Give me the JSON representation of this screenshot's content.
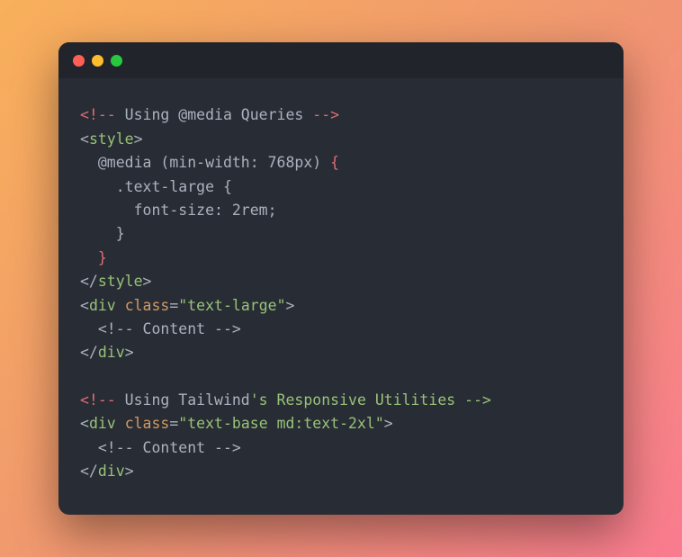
{
  "code": {
    "l1": {
      "a": "<!-- ",
      "b": "Using @media Queries ",
      "c": "-->"
    },
    "l2": {
      "a": "<",
      "b": "style",
      "c": ">"
    },
    "l3": {
      "a": "  @media (min-width: 768px) ",
      "b": "{"
    },
    "l4": "    .text-large {",
    "l5": "      font-size: 2rem;",
    "l6": "    }",
    "l7": {
      "a": "  ",
      "b": "}"
    },
    "l8": {
      "a": "</",
      "b": "style",
      "c": ">"
    },
    "l9": {
      "a": "<",
      "b": "div",
      "c": " ",
      "d": "class",
      "e": "=",
      "f": "\"text-large\"",
      "g": ">"
    },
    "l10": {
      "a": "  <!-- ",
      "b": "Content ",
      "c": "-->"
    },
    "l11": {
      "a": "</",
      "b": "div",
      "c": ">"
    },
    "l12": "",
    "l13": {
      "a": "<!-- ",
      "b": "Using Tailwind",
      "c": "'s Responsive Utilities -->"
    },
    "l14": {
      "a": "<",
      "b": "div",
      "c": " ",
      "d": "class",
      "e": "=",
      "f": "\"text-base md:text-2xl\"",
      "g": ">"
    },
    "l15": {
      "a": "  <!-- ",
      "b": "Content ",
      "c": "-->"
    },
    "l16": {
      "a": "</",
      "b": "div",
      "c": ">"
    }
  }
}
